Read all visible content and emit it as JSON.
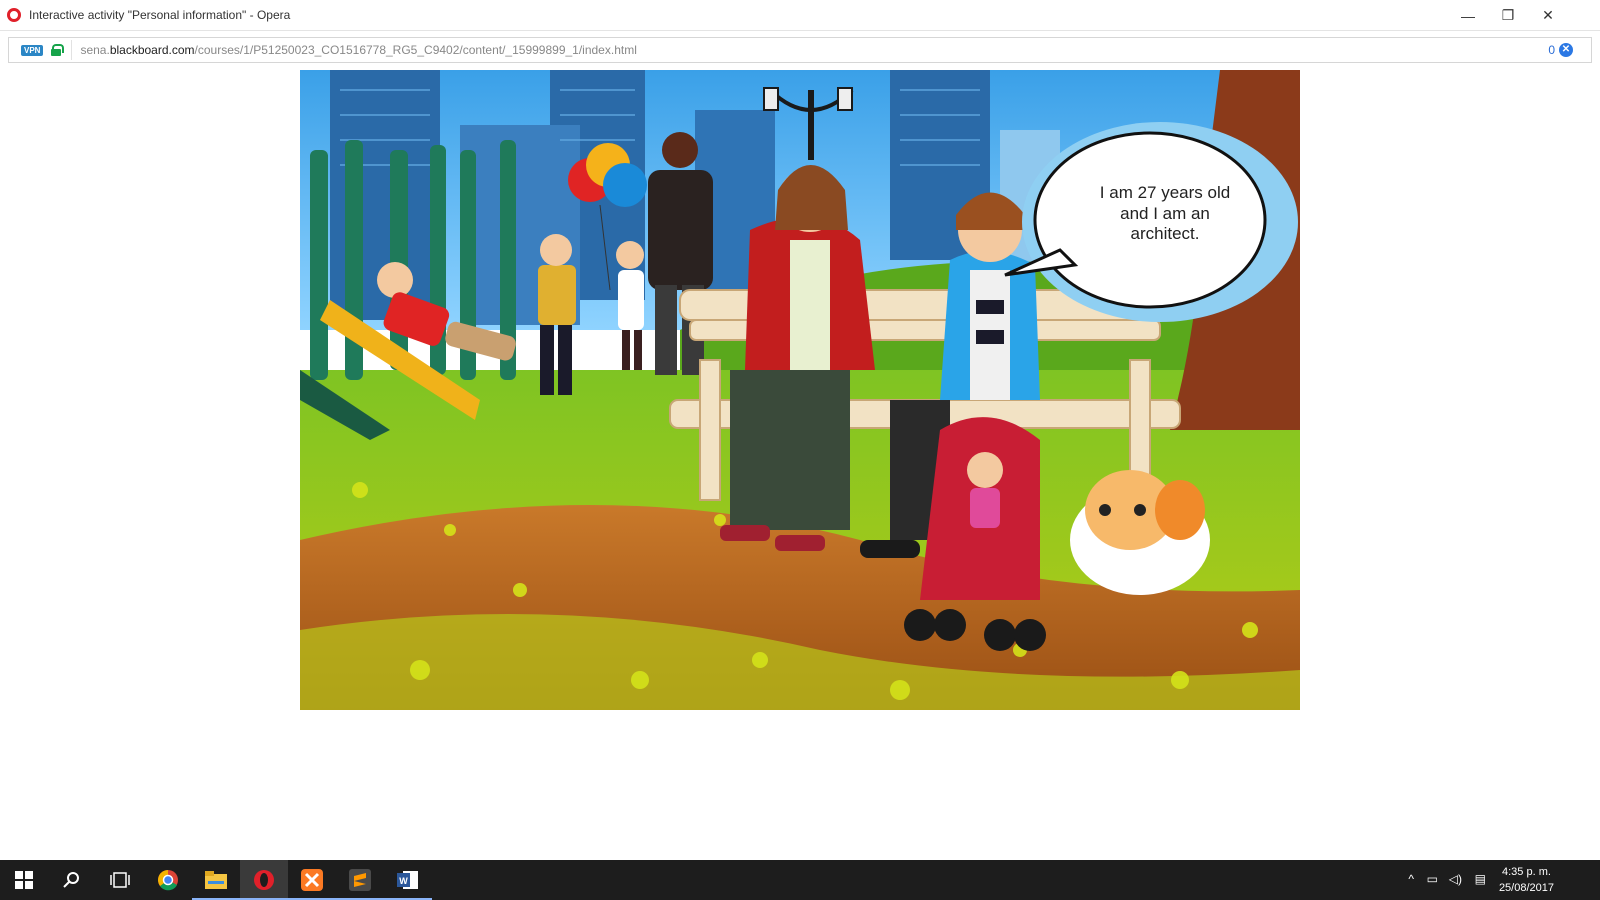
{
  "window": {
    "title": "Interactive activity \"Personal information\" - Opera",
    "controls": {
      "minimize": "—",
      "restore": "❐",
      "close": "✕"
    }
  },
  "addressbar": {
    "vpn_label": "VPN",
    "url_prefix": "sena.",
    "url_domain": "blackboard.com",
    "url_path": "/courses/1/P51250023_CO1516778_RG5_C9402/content/_15999899_1/index.html",
    "blocked_count": "0",
    "blocker_icon": "adblock-icon"
  },
  "scene": {
    "speech_bubble": {
      "line1": "I am 27 years old",
      "line2": "and I am an",
      "line3": "architect."
    },
    "colors": {
      "sky": "#5bb8f0",
      "grass": "#9cc41c",
      "path": "#b5651d",
      "bench": "#f2e2c4",
      "tree": "#8b3a1a"
    }
  },
  "taskbar": {
    "icons": [
      "windows-start-icon",
      "search-icon",
      "task-view-icon",
      "chrome-icon",
      "file-explorer-icon",
      "opera-icon",
      "xampp-icon",
      "sublime-text-icon",
      "word-icon"
    ],
    "clock_time": "4:35 p. m.",
    "clock_date": "25/08/2017"
  }
}
